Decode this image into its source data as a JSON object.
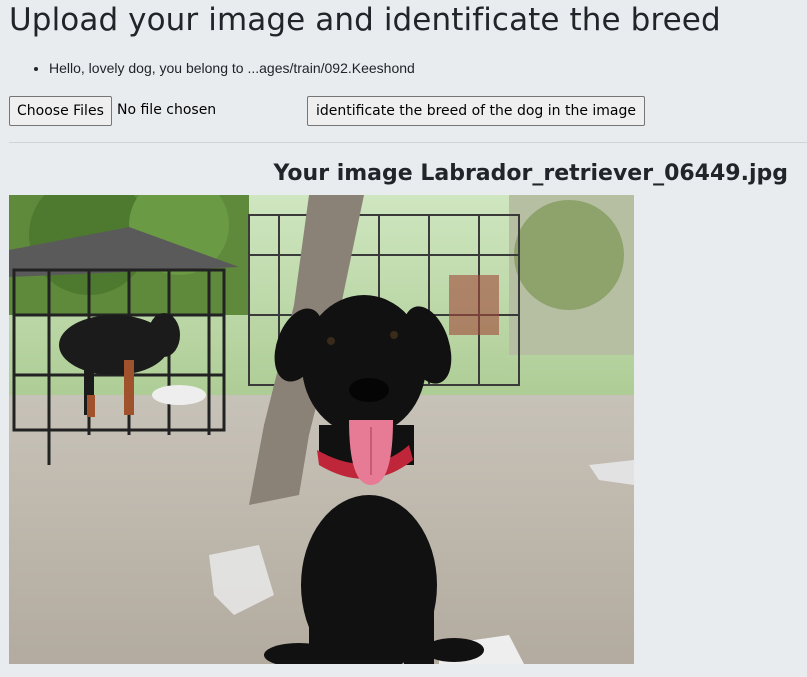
{
  "header": {
    "title": "Upload your image and identificate the breed"
  },
  "results": [
    "Hello, lovely dog, you belong to ...ages/train/092.Keeshond"
  ],
  "upload": {
    "choose_files_label": "Choose Files",
    "file_status": "No file chosen",
    "submit_label": "identificate the breed of the dog in the image"
  },
  "preview": {
    "caption": "Your image Labrador_retriever_06449.jpg"
  },
  "colors": {
    "page_background": "#e9ecef",
    "text": "#212529",
    "button_background": "#efefef",
    "button_border": "#767676"
  }
}
